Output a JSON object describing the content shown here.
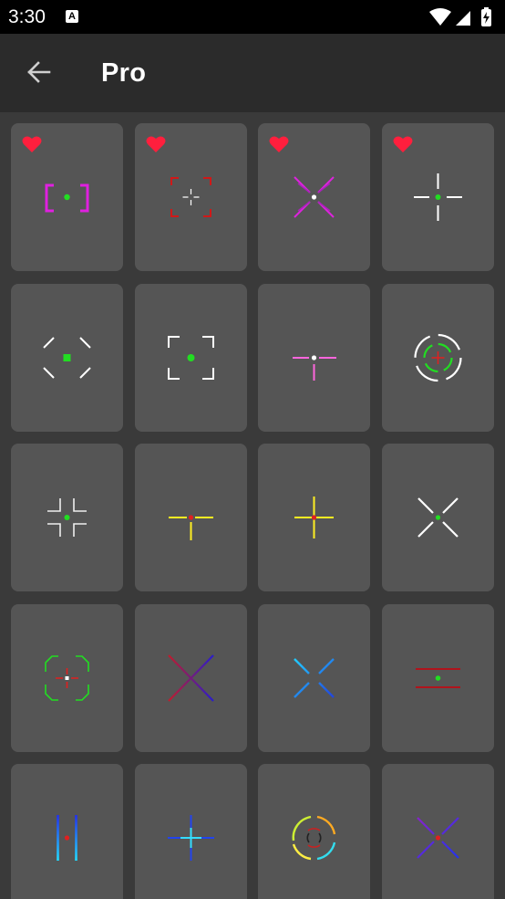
{
  "status_bar": {
    "time": "3:30",
    "notification_icon": "A",
    "icons": [
      "wifi-icon",
      "signal-icon",
      "battery-charging-icon"
    ]
  },
  "app_bar": {
    "title": "Pro",
    "back_icon": "arrow-left-icon"
  },
  "colors": {
    "background": "#3a3a3a",
    "card": "#555555",
    "app_bar": "#2b2b2b",
    "favorite": "#ff1f3d"
  },
  "crosshairs": [
    {
      "id": "brackets-magenta",
      "favorite": true
    },
    {
      "id": "corners-red",
      "favorite": true
    },
    {
      "id": "x-magenta",
      "favorite": true
    },
    {
      "id": "cross-white-green-dot",
      "favorite": true
    },
    {
      "id": "diagonal-corners-green-square",
      "favorite": false
    },
    {
      "id": "square-corners-green-dot",
      "favorite": false
    },
    {
      "id": "t-pink",
      "favorite": false
    },
    {
      "id": "circle-dashed-green-red",
      "favorite": false
    },
    {
      "id": "l-corners-white",
      "favorite": false
    },
    {
      "id": "t-yellow",
      "favorite": false
    },
    {
      "id": "cross-yellow-red",
      "favorite": false
    },
    {
      "id": "x-white-green-dot",
      "favorite": false
    },
    {
      "id": "octagon-green-red",
      "favorite": false
    },
    {
      "id": "x-gradient-red-blue",
      "favorite": false
    },
    {
      "id": "x-cyan-blue",
      "favorite": false
    },
    {
      "id": "lines-red-horizontal",
      "favorite": false
    },
    {
      "id": "bars-blue-cyan",
      "favorite": false
    },
    {
      "id": "cross-blue-cyan",
      "favorite": false
    },
    {
      "id": "circle-rainbow",
      "favorite": false
    },
    {
      "id": "x-purple-blue-red-dot",
      "favorite": false
    }
  ]
}
